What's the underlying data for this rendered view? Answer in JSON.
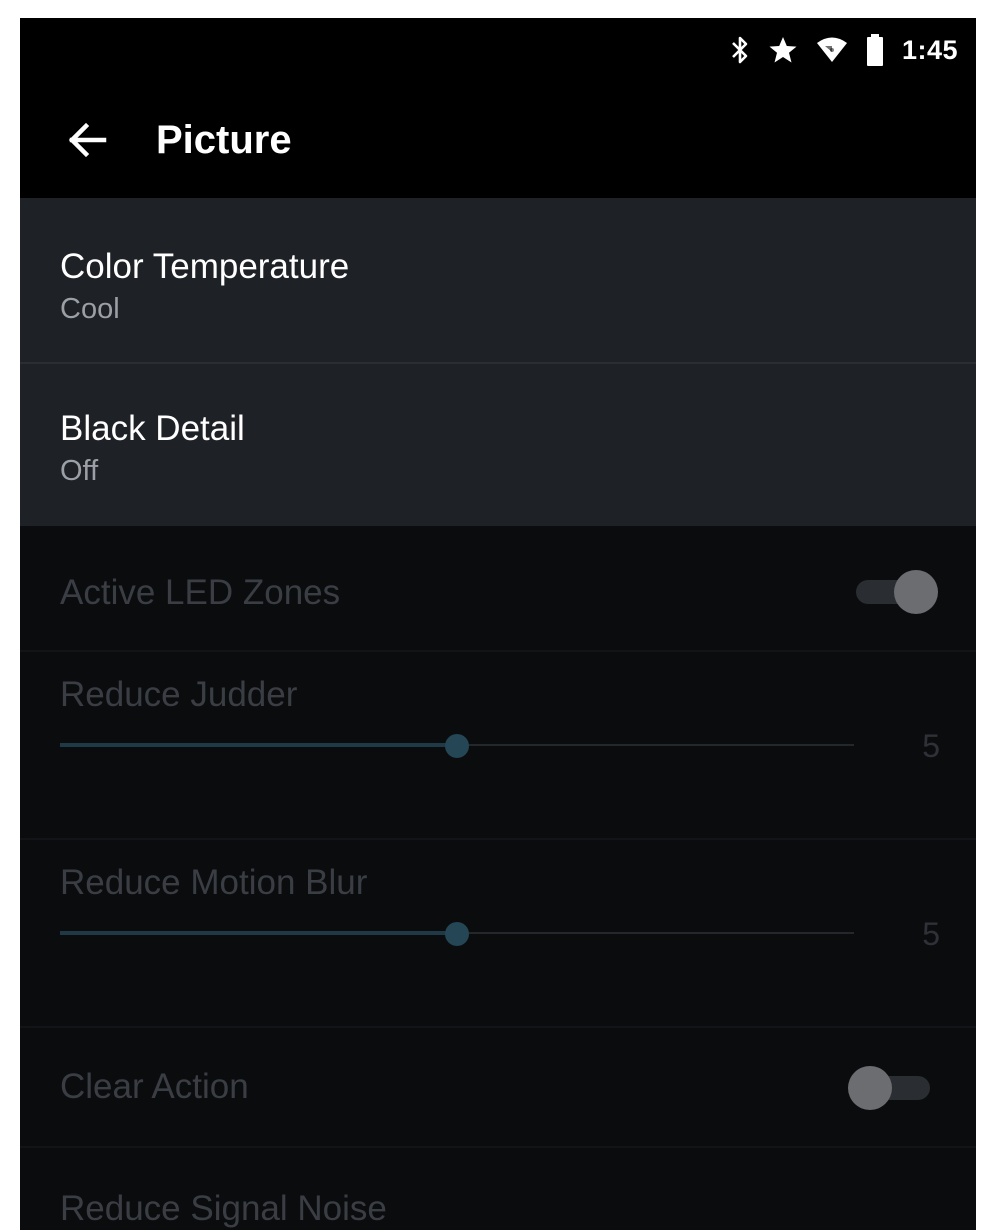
{
  "status": {
    "time": "1:45",
    "icons": [
      "bluetooth-icon",
      "star-icon",
      "wifi-icon",
      "battery-icon"
    ]
  },
  "header": {
    "title": "Picture",
    "back_icon": "arrow-left-icon"
  },
  "settings": {
    "color_temperature": {
      "label": "Color Temperature",
      "value": "Cool"
    },
    "black_detail": {
      "label": "Black Detail",
      "value": "Off"
    },
    "active_led_zones": {
      "label": "Active LED Zones",
      "on": true
    },
    "reduce_judder": {
      "label": "Reduce Judder",
      "value": "5",
      "level": 0.5
    },
    "reduce_motion_blur": {
      "label": "Reduce Motion Blur",
      "value": "5",
      "level": 0.5
    },
    "clear_action": {
      "label": "Clear Action",
      "on": false
    },
    "reduce_signal_noise": {
      "label": "Reduce Signal Noise"
    }
  },
  "colors": {
    "enabled_row": "#1e2126",
    "disabled_row": "#0b0c0e",
    "slider_accent": "#254654"
  }
}
